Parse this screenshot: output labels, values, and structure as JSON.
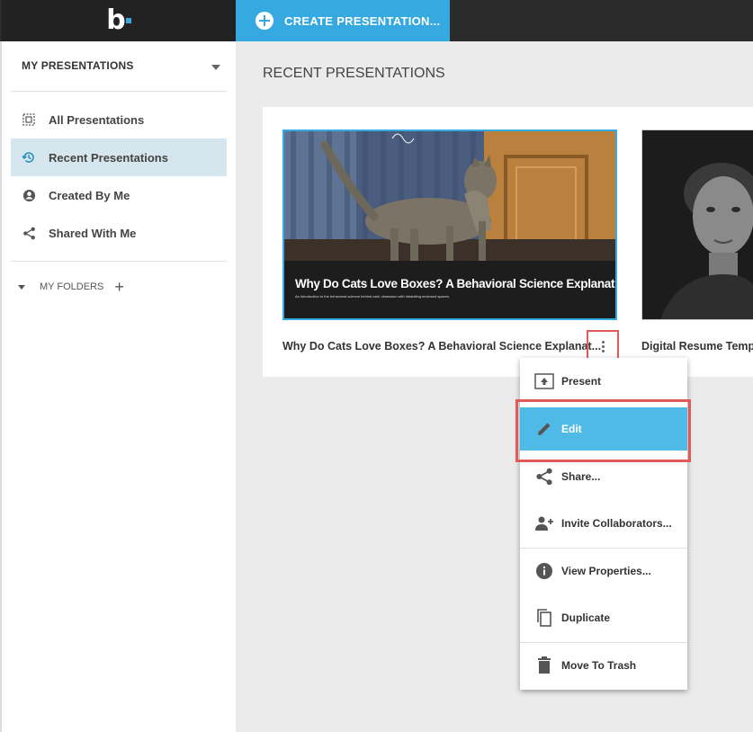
{
  "brand": {
    "logo_text": "b",
    "accent": "#36a9e1"
  },
  "header": {
    "create_label": "CREATE PRESENTATION..."
  },
  "sidebar": {
    "heading": "MY PRESENTATIONS",
    "items": [
      {
        "label": "All Presentations",
        "icon": "grid-icon",
        "active": false
      },
      {
        "label": "Recent Presentations",
        "icon": "history-icon",
        "active": true
      },
      {
        "label": "Created By Me",
        "icon": "user-icon",
        "active": false
      },
      {
        "label": "Shared With Me",
        "icon": "share-icon",
        "active": false
      }
    ],
    "folders_label": "MY FOLDERS"
  },
  "main": {
    "title": "RECENT PRESENTATIONS",
    "presentations": [
      {
        "name": "Why Do Cats Love Boxes? A Behavioral Science Explanat...",
        "thumb_title": "Why Do Cats Love Boxes? A Behavioral Science Explanation",
        "thumb_subtitle": "An introduction to the behavioral science behind cats' obsession with inhabiting enclosed spaces."
      },
      {
        "name": "Digital Resume Temp"
      }
    ]
  },
  "context_menu": {
    "items": [
      {
        "label": "Present",
        "icon": "present-icon"
      },
      {
        "label": "Edit",
        "icon": "pencil-icon",
        "active": true
      },
      {
        "label": "Share...",
        "icon": "share-icon"
      },
      {
        "label": "Invite Collaborators...",
        "icon": "add-person-icon"
      },
      {
        "label": "View Properties...",
        "icon": "info-icon"
      },
      {
        "label": "Duplicate",
        "icon": "copy-icon"
      },
      {
        "label": "Move To Trash",
        "icon": "trash-icon"
      }
    ]
  }
}
